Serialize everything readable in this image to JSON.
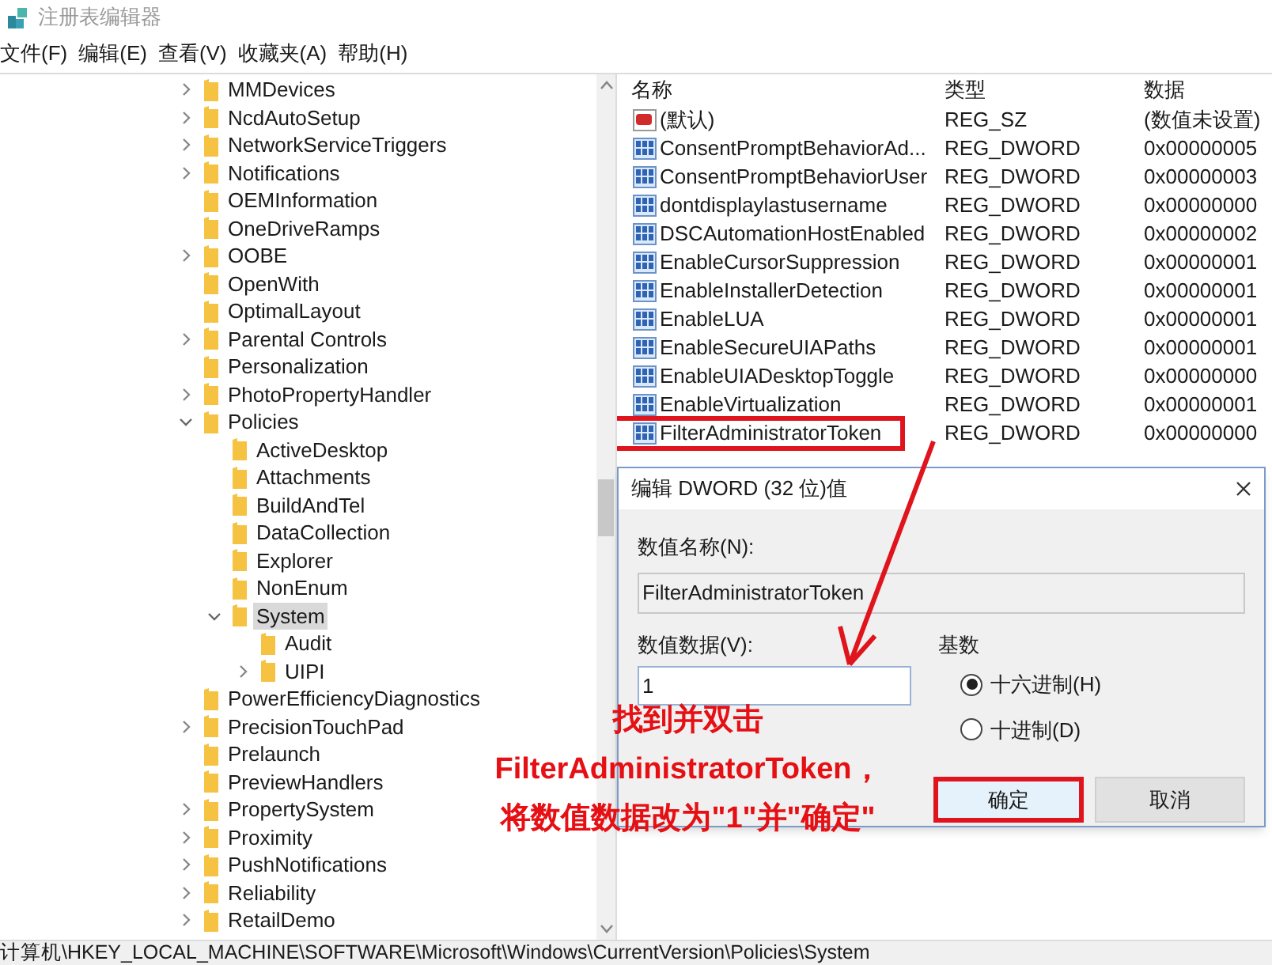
{
  "window": {
    "title": "注册表编辑器"
  },
  "menu": [
    "文件(F)",
    "编辑(E)",
    "查看(V)",
    "收藏夹(A)",
    "帮助(H)"
  ],
  "tree": [
    {
      "label": "MMDevices",
      "expandable": true,
      "expanded": false,
      "selected": false
    },
    {
      "label": "NcdAutoSetup",
      "expandable": true,
      "expanded": false,
      "selected": false
    },
    {
      "label": "NetworkServiceTriggers",
      "expandable": true,
      "expanded": false,
      "selected": false
    },
    {
      "label": "Notifications",
      "expandable": true,
      "expanded": false,
      "selected": false
    },
    {
      "label": "OEMInformation",
      "expandable": false,
      "selected": false
    },
    {
      "label": "OneDriveRamps",
      "expandable": false,
      "selected": false
    },
    {
      "label": "OOBE",
      "expandable": true,
      "expanded": false,
      "selected": false
    },
    {
      "label": "OpenWith",
      "expandable": false,
      "selected": false
    },
    {
      "label": "OptimalLayout",
      "expandable": false,
      "selected": false
    },
    {
      "label": "Parental Controls",
      "expandable": true,
      "expanded": false,
      "selected": false
    },
    {
      "label": "Personalization",
      "expandable": false,
      "selected": false
    },
    {
      "label": "PhotoPropertyHandler",
      "expandable": true,
      "expanded": false,
      "selected": false
    },
    {
      "label": "Policies",
      "expandable": true,
      "expanded": true,
      "selected": false,
      "children": [
        {
          "label": "ActiveDesktop",
          "expandable": false,
          "selected": false
        },
        {
          "label": "Attachments",
          "expandable": false,
          "selected": false
        },
        {
          "label": "BuildAndTel",
          "expandable": false,
          "selected": false
        },
        {
          "label": "DataCollection",
          "expandable": false,
          "selected": false
        },
        {
          "label": "Explorer",
          "expandable": false,
          "selected": false
        },
        {
          "label": "NonEnum",
          "expandable": false,
          "selected": false
        },
        {
          "label": "System",
          "expandable": true,
          "expanded": true,
          "selected": true,
          "children": [
            {
              "label": "Audit",
              "expandable": false,
              "selected": false
            },
            {
              "label": "UIPI",
              "expandable": true,
              "expanded": false,
              "selected": false
            }
          ]
        }
      ]
    },
    {
      "label": "PowerEfficiencyDiagnostics",
      "expandable": false,
      "selected": false
    },
    {
      "label": "PrecisionTouchPad",
      "expandable": true,
      "expanded": false,
      "selected": false
    },
    {
      "label": "Prelaunch",
      "expandable": false,
      "selected": false
    },
    {
      "label": "PreviewHandlers",
      "expandable": false,
      "selected": false
    },
    {
      "label": "PropertySystem",
      "expandable": true,
      "expanded": false,
      "selected": false
    },
    {
      "label": "Proximity",
      "expandable": true,
      "expanded": false,
      "selected": false
    },
    {
      "label": "PushNotifications",
      "expandable": true,
      "expanded": false,
      "selected": false
    },
    {
      "label": "Reliability",
      "expandable": true,
      "expanded": false,
      "selected": false
    },
    {
      "label": "RetailDemo",
      "expandable": true,
      "expanded": false,
      "selected": false
    }
  ],
  "list": {
    "columns": [
      "名称",
      "类型",
      "数据"
    ],
    "rows": [
      {
        "kind": "string",
        "name": "(默认)",
        "type": "REG_SZ",
        "data": "(数值未设置)",
        "highlighted": false
      },
      {
        "kind": "dword",
        "name": "ConsentPromptBehaviorAd...",
        "type": "REG_DWORD",
        "data": "0x00000005",
        "highlighted": false
      },
      {
        "kind": "dword",
        "name": "ConsentPromptBehaviorUser",
        "type": "REG_DWORD",
        "data": "0x00000003",
        "highlighted": false
      },
      {
        "kind": "dword",
        "name": "dontdisplaylastusername",
        "type": "REG_DWORD",
        "data": "0x00000000",
        "highlighted": false
      },
      {
        "kind": "dword",
        "name": "DSCAutomationHostEnabled",
        "type": "REG_DWORD",
        "data": "0x00000002",
        "highlighted": false
      },
      {
        "kind": "dword",
        "name": "EnableCursorSuppression",
        "type": "REG_DWORD",
        "data": "0x00000001",
        "highlighted": false
      },
      {
        "kind": "dword",
        "name": "EnableInstallerDetection",
        "type": "REG_DWORD",
        "data": "0x00000001",
        "highlighted": false
      },
      {
        "kind": "dword",
        "name": "EnableLUA",
        "type": "REG_DWORD",
        "data": "0x00000001",
        "highlighted": false
      },
      {
        "kind": "dword",
        "name": "EnableSecureUIAPaths",
        "type": "REG_DWORD",
        "data": "0x00000001",
        "highlighted": false
      },
      {
        "kind": "dword",
        "name": "EnableUIADesktopToggle",
        "type": "REG_DWORD",
        "data": "0x00000000",
        "highlighted": false
      },
      {
        "kind": "dword",
        "name": "EnableVirtualization",
        "type": "REG_DWORD",
        "data": "0x00000001",
        "highlighted": false
      },
      {
        "kind": "dword",
        "name": "FilterAdministratorToken",
        "type": "REG_DWORD",
        "data": "0x00000000",
        "highlighted": true
      }
    ]
  },
  "dialog": {
    "title": "编辑 DWORD (32 位)值",
    "name_label": "数值名称(N):",
    "name_value": "FilterAdministratorToken",
    "data_label": "数值数据(V):",
    "data_value": "1",
    "base_label": "基数",
    "base_options": [
      {
        "label": "十六进制(H)",
        "selected": true
      },
      {
        "label": "十进制(D)",
        "selected": false
      }
    ],
    "buttons": [
      {
        "label": "确定",
        "highlighted": true
      },
      {
        "label": "取消",
        "highlighted": false
      }
    ]
  },
  "annotation": {
    "lines": [
      "找到并双击",
      "FilterAdministratorToken，",
      "将数值数据改为\"1\"并\"确定\""
    ]
  },
  "status_bar": "计算机\\HKEY_LOCAL_MACHINE\\SOFTWARE\\Microsoft\\Windows\\CurrentVersion\\Policies\\System"
}
